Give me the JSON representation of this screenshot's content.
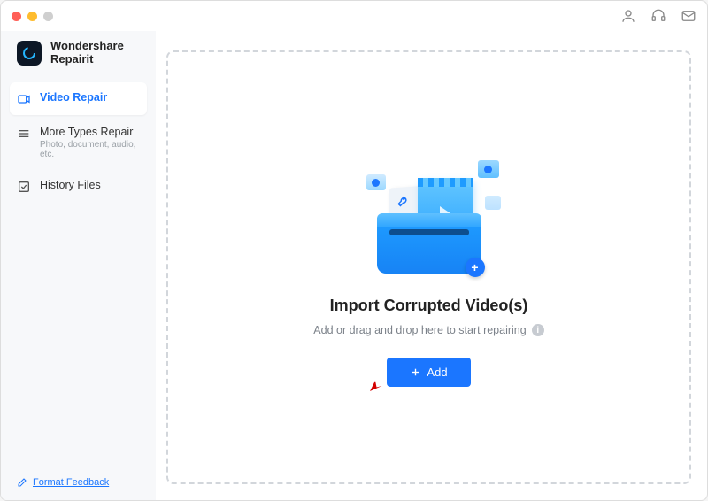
{
  "brand": {
    "line1": "Wondershare",
    "line2": "Repairit"
  },
  "sidebar": {
    "items": [
      {
        "label": "Video Repair"
      },
      {
        "label": "More Types Repair",
        "sub": "Photo, document, audio, etc."
      },
      {
        "label": "History Files"
      }
    ],
    "feedback": "Format Feedback"
  },
  "main": {
    "title": "Import Corrupted Video(s)",
    "subtitle": "Add or drag and drop here to start repairing",
    "add_label": "Add"
  },
  "icons": {
    "account": "account-icon",
    "support": "support-icon",
    "mail": "mail-icon"
  }
}
